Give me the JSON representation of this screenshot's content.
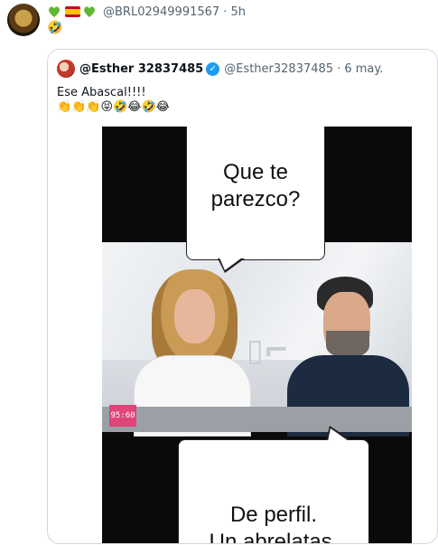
{
  "tweet": {
    "display_emojis": [
      "💚",
      "🇪🇸",
      "💚"
    ],
    "handle": "@BRL02949991567",
    "time": "· 5h",
    "text_emoji": "🤣"
  },
  "quoted_tweet": {
    "name": "@Esther 32837485",
    "handle": "@Esther32837485",
    "date": "· 6 may.",
    "text": "Ese Abascal!!!!",
    "emojis": "👏👏👏😝🤣😂🤣😂"
  },
  "media": {
    "bubble_top_line1": "Que te",
    "bubble_top_line2": "parezco?",
    "bubble_bottom_line1": "De perfil.",
    "bubble_bottom_line2": "Un abrelatas.",
    "screen_number": "95:60"
  },
  "colors": {
    "verified": "#1d9bf0",
    "secondary_text": "#536471",
    "border": "#cfd9de"
  }
}
